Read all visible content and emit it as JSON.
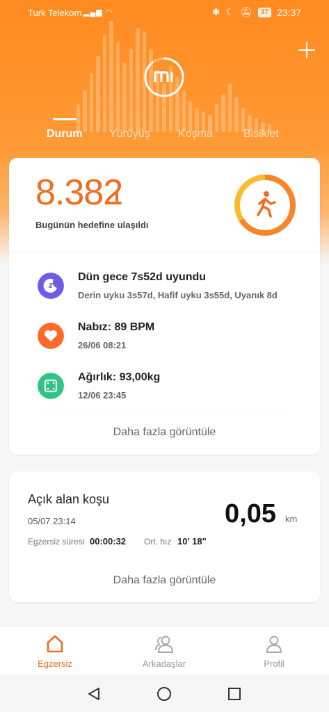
{
  "status_bar": {
    "carrier": "Turk Telekom",
    "battery": "37",
    "time": "23:37"
  },
  "tabs": [
    {
      "label": "Durum",
      "active": true
    },
    {
      "label": "Yürüyüş",
      "active": false
    },
    {
      "label": "Koşma",
      "active": false
    },
    {
      "label": "Bisiklet",
      "active": false
    }
  ],
  "steps": {
    "value": "8.382",
    "goal_text": "Bugünün hedefine ulaşıldı",
    "icon": "walking-icon"
  },
  "sleep": {
    "title": "Dün gece 7s52d uyundu",
    "detail": "Derin uyku 3s57d, Hafif uyku 3s55d, Uyanık 8d",
    "icon": "moon-icon",
    "color": "#6e5ce6"
  },
  "heart": {
    "title": "Nabız: 89 BPM",
    "detail": "26/06 08:21",
    "icon": "heart-icon",
    "color": "#ff6a2a"
  },
  "weight": {
    "title": "Ağırlık: 93,00kg",
    "detail": "12/06 23:45",
    "icon": "scale-icon",
    "color": "#2fc585"
  },
  "card1_more": "Daha fazla görüntüle",
  "run": {
    "title": "Açık alan koşu",
    "date": "05/07 23:14",
    "duration_label": "Egzersiz süresi",
    "duration_value": "00:00:32",
    "pace_label": "Ort. hız",
    "pace_value": "10' 18\"",
    "distance": "0,05",
    "unit": "km",
    "more": "Daha fazla görüntüle"
  },
  "bottom_nav": [
    {
      "label": "Egzersiz",
      "icon": "home-icon",
      "active": true
    },
    {
      "label": "Arkadaşlar",
      "icon": "friends-icon",
      "active": false
    },
    {
      "label": "Profil",
      "icon": "profile-icon",
      "active": false
    }
  ],
  "colors": {
    "accent": "#f36b1c",
    "header": "#ff8a1f"
  }
}
